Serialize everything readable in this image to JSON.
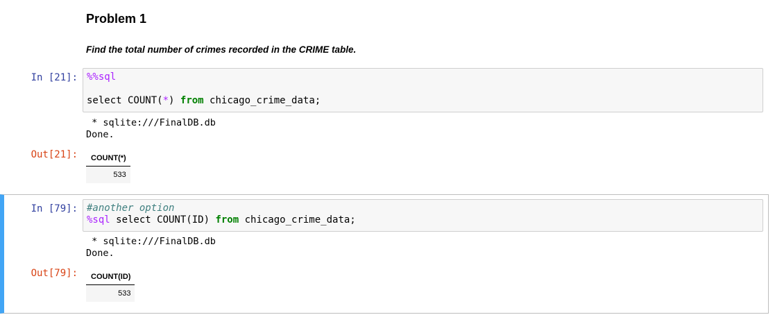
{
  "markdown": {
    "title": "Problem 1",
    "description": "Find the total number of crimes recorded in the CRIME table."
  },
  "cells": [
    {
      "in_prompt": "In [21]:",
      "code": {
        "line1_magic": "%%sql",
        "line2_kw1": "select",
        "line2_func": " COUNT(",
        "line2_star": "*",
        "line2_close": ") ",
        "line2_kw2": "from",
        "line2_rest": " chicago_crime_data;"
      },
      "stdout_line1": " * sqlite:///FinalDB.db",
      "stdout_line2": "Done.",
      "out_prompt": "Out[21]:",
      "table_header": "COUNT(*)",
      "table_value": "533"
    },
    {
      "in_prompt": "In [79]:",
      "code": {
        "line1_comment": "#another option",
        "line2_magic": "%sql",
        "line2_func": " select COUNT(ID) ",
        "line2_kw": "from",
        "line2_rest": " chicago_crime_data;"
      },
      "stdout_line1": " * sqlite:///FinalDB.db",
      "stdout_line2": "Done.",
      "out_prompt": "Out[79]:",
      "table_header": "COUNT(ID)",
      "table_value": "533"
    }
  ],
  "colors": {
    "in_prompt": "#303f9f",
    "out_prompt": "#d84315",
    "selected_cell_accent": "#42a5f5",
    "keyword": "#008000",
    "magic": "#aa22ff",
    "comment": "#408080"
  }
}
